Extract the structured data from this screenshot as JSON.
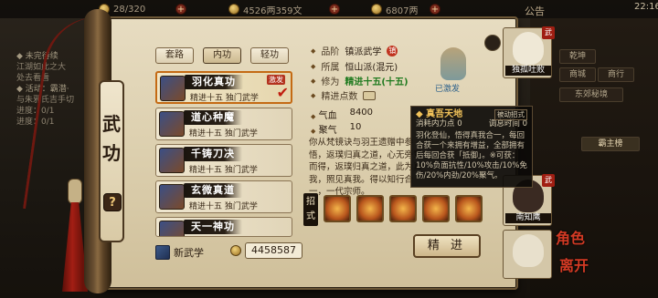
{
  "topbar": {
    "stamina": "28/320",
    "coins": "4526两359文",
    "silver": "6807两",
    "notice": "公告",
    "time": "22:16"
  },
  "quest": {
    "line1": "◆ 未完待续",
    "line2": "江湖如此之大",
    "line3": "处去看看",
    "line4": "◆ 活动：霸潜·",
    "line5": "与朱邪氏吉手切",
    "line6": "进度：0/1",
    "line7": "进度：0/1"
  },
  "panel": {
    "side_title": "武功",
    "help": "?",
    "tabs": [
      "套路",
      "内功",
      "轻功"
    ],
    "active_tab": 1
  },
  "skills": [
    {
      "name": "羽化真功",
      "sub": "精进十五  独门武学",
      "badge": "激发",
      "selected": true,
      "equipped": true
    },
    {
      "name": "道心种魔",
      "sub": "精进十五  独门武学",
      "badge": "",
      "selected": false,
      "equipped": false
    },
    {
      "name": "千铸刀决",
      "sub": "精进十五  独门武学",
      "badge": "",
      "selected": false,
      "equipped": false
    },
    {
      "name": "玄微真道",
      "sub": "精进十五  独门武学",
      "badge": "",
      "selected": false,
      "equipped": false
    },
    {
      "name": "天一神功",
      "sub": "",
      "badge": "",
      "selected": false,
      "equipped": false
    }
  ],
  "footer": {
    "new_skill": "新武学",
    "money": "4458587"
  },
  "detail": {
    "rank_label": "品阶",
    "rank_value": "镇派武学",
    "rank_tag": "镇",
    "school_label": "所属",
    "school_value": "恒山派(混元)",
    "cultivation_label": "修为",
    "cultivation_value": "精进十五(十五)",
    "points_label": "精进点数",
    "hp_label": "气血",
    "hp_value": "8400",
    "qi_label": "聚气",
    "qi_value": "10",
    "activated": "已激发",
    "description": "你从梵镜诀与羽王遗赠中参悟，返璞归真之道，心无旁骛而得，返璞归真之道，此为真我，照见真我。得以知行合一，一代宗师。",
    "moves_label": "招式",
    "practice_button": "精 进"
  },
  "tooltip": {
    "title": "真吾天地",
    "badge": "被动招式",
    "cost_label": "消耗内力点",
    "cost_value": "0",
    "cd_label": "调息时间",
    "cd_value": "0",
    "body": "羽化登仙，悟得真我合一，每回合获一个来拥有增益，全部拥有后每回合获「抵御」。※可获：10%负面抗性/10%攻击/10%免伤/20%内劲/20%聚气。"
  },
  "right": {
    "heroes": [
      {
        "name": "独孤吐败",
        "tag": "武"
      },
      {
        "name": "南知鹰",
        "tag": "武"
      },
      {
        "name": "",
        "tag": ""
      }
    ],
    "buttons": [
      "乾坤",
      "商城",
      "东郊秘境",
      "霸主榜"
    ],
    "role_text": "角色",
    "leave_text": "离开"
  },
  "colors": {
    "accent": "#c46a14",
    "tooltip_title": "#f2c35a",
    "green_text": "#1f7a1f",
    "badge_red": "#b3321e"
  }
}
